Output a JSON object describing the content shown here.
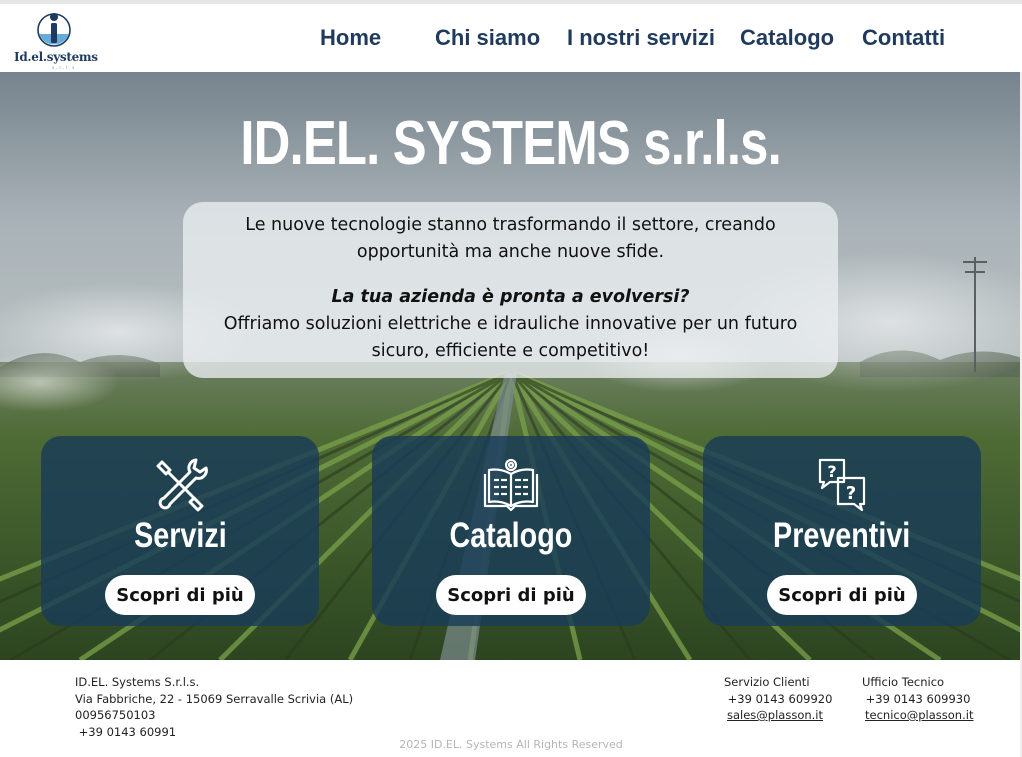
{
  "brand": {
    "logo_text": "Id.el.systems",
    "logo_tagline": "s.r.l.s",
    "primary_color": "#1f3a5c",
    "card_color": "#193c58"
  },
  "nav": {
    "items": [
      {
        "label": "Home"
      },
      {
        "label": "Chi siamo"
      },
      {
        "label": "I nostri servizi"
      },
      {
        "label": "Catalogo"
      },
      {
        "label": "Contatti"
      }
    ]
  },
  "hero": {
    "title": "ID.EL. SYSTEMS s.r.l.s.",
    "intro_line1": "Le nuove tecnologie stanno trasformando il settore, creando",
    "intro_line2": "opportunità ma anche nuove sfide.",
    "question": "La tua azienda è pronta a evolversi?",
    "offer_line1": "Offriamo soluzioni elettriche e idrauliche innovative per un futuro",
    "offer_line2": "sicuro, efficiente e competitivo!"
  },
  "cards": [
    {
      "title": "Servizi",
      "icon": "tools-icon",
      "button": "Scopri di più"
    },
    {
      "title": "Catalogo",
      "icon": "catalog-book-icon",
      "button": "Scopri di più"
    },
    {
      "title": "Preventivi",
      "icon": "question-bubbles-icon",
      "button": "Scopri di più"
    }
  ],
  "footer": {
    "company": {
      "name": "ID.EL. Systems S.r.l.s.",
      "address": "Via Fabbriche, 22 - 15069 Serravalle Scrivia (AL)",
      "vat": "00956750103",
      "phone": " +39 0143 60991"
    },
    "customer_service": {
      "heading": "Servizio Clienti",
      "phone": " +39 0143 609920",
      "email": "sales@plasson.it"
    },
    "tech_office": {
      "heading": "Ufficio Tecnico",
      "phone": " +39 0143 609930",
      "email": "tecnico@plasson.it"
    },
    "copyright": "2025 ID.EL. Systems All Rights Reserved"
  }
}
